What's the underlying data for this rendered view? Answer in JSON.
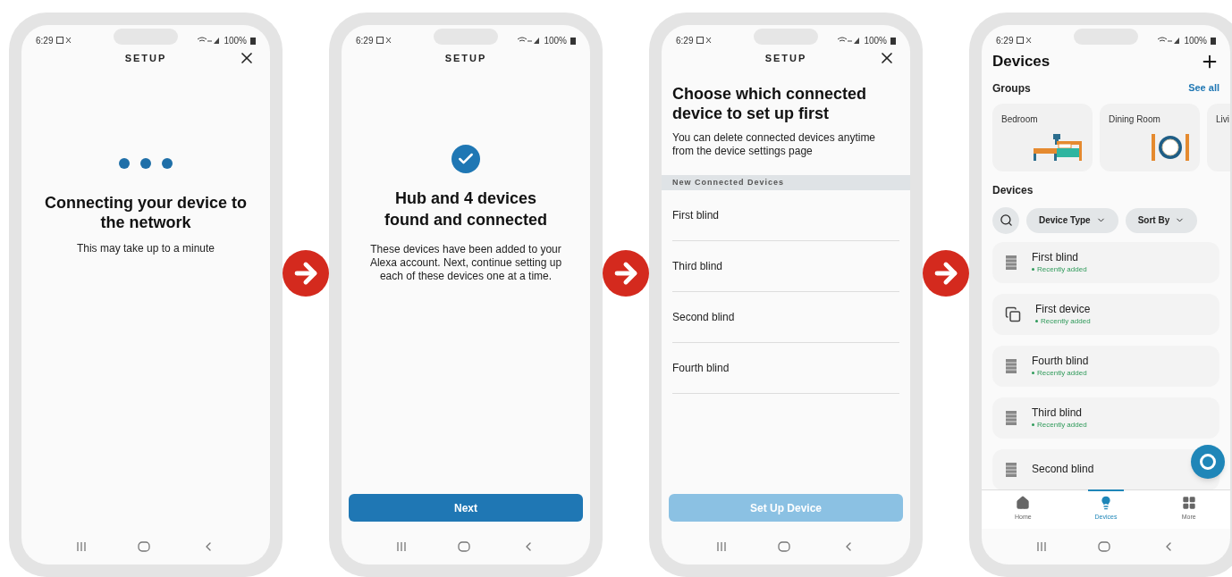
{
  "phones": [
    {
      "kind": "connecting",
      "status_bar": {
        "time": "6:29",
        "battery": "100%"
      },
      "title": "SETUP",
      "close": true,
      "heading": "Connecting your device to the network",
      "subtitle": "This may take up to a minute"
    },
    {
      "kind": "found",
      "status_bar": {
        "time": "6:29",
        "battery": "100%"
      },
      "title": "SETUP",
      "close": false,
      "heading": "Hub and 4 devices found and connected",
      "body": "These devices have been added to your Alexa account. Next, continue setting up each of these devices one at a time.",
      "button": {
        "label": "Next",
        "disabled": false
      }
    },
    {
      "kind": "choose",
      "status_bar": {
        "time": "6:29",
        "battery": "100%"
      },
      "title": "SETUP",
      "close": true,
      "heading": "Choose which connected device to set up first",
      "body": "You can delete connected devices anytime from the device settings page",
      "section_label": "New Connected Devices",
      "items": [
        "First blind",
        "Third blind",
        "Second blind",
        "Fourth blind"
      ],
      "button": {
        "label": "Set Up Device",
        "disabled": true
      }
    },
    {
      "kind": "devices",
      "status_bar": {
        "time": "6:29",
        "battery": "100%"
      },
      "title": "Devices",
      "groups_label": "Groups",
      "see_all": "See all",
      "groups": [
        {
          "name": "Bedroom",
          "kind": "bed"
        },
        {
          "name": "Dining Room",
          "kind": "dining"
        },
        {
          "name": "Livi",
          "kind": "none"
        }
      ],
      "devices_label": "Devices",
      "filters": [
        "Device Type",
        "Sort By"
      ],
      "devices": [
        {
          "name": "First blind",
          "status": "Recently added",
          "kind": "blind"
        },
        {
          "name": "First device",
          "status": "Recently added",
          "kind": "device"
        },
        {
          "name": "Fourth blind",
          "status": "Recently added",
          "kind": "blind"
        },
        {
          "name": "Third blind",
          "status": "Recently added",
          "kind": "blind"
        },
        {
          "name": "Second blind",
          "kind": "blind"
        }
      ],
      "tabs": [
        {
          "label": "Home",
          "selected": false
        },
        {
          "label": "Devices",
          "selected": true
        },
        {
          "label": "More",
          "selected": false
        }
      ]
    }
  ]
}
